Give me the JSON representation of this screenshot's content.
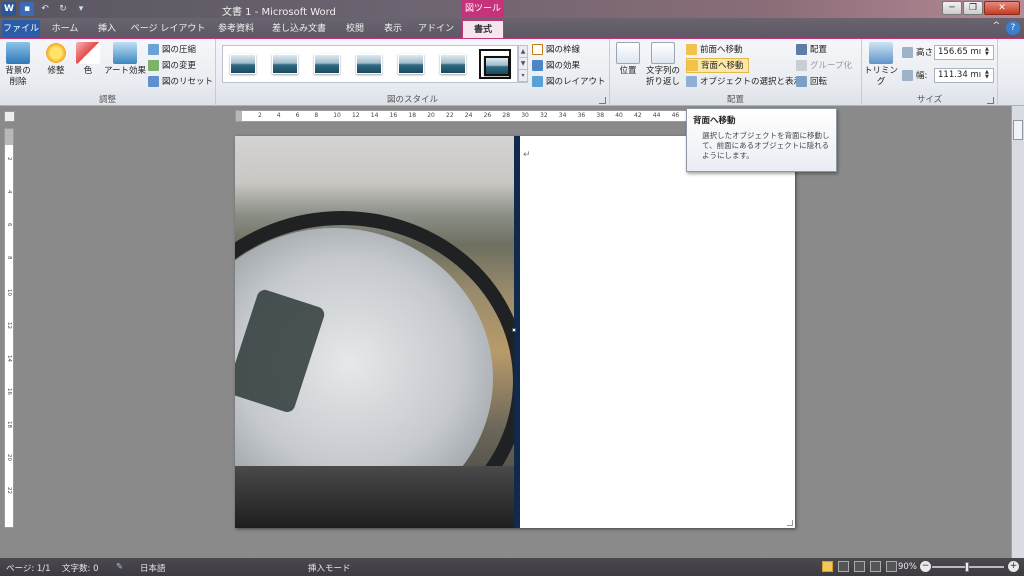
{
  "window": {
    "title": "文書 1 - Microsoft Word",
    "context_tool": "図ツール",
    "minimize": "─",
    "restore": "❐",
    "close": "✕",
    "help": "?",
    "ribbon_toggle": "^"
  },
  "tabs": [
    {
      "label": "ファイル"
    },
    {
      "label": "ホーム"
    },
    {
      "label": "挿入"
    },
    {
      "label": "ページ レイアウト"
    },
    {
      "label": "参考資料"
    },
    {
      "label": "差し込み文書"
    },
    {
      "label": "校閲"
    },
    {
      "label": "表示"
    },
    {
      "label": "アドイン"
    },
    {
      "label": "書式"
    }
  ],
  "ribbon": {
    "adjust": {
      "label": "調整",
      "remove_bg": "背景の削除",
      "correct": "修整",
      "color": "色",
      "art_effects": "アート効果",
      "compress": "図の圧縮",
      "change": "図の変更",
      "reset": "図のリセット"
    },
    "styles": {
      "label": "図のスタイル",
      "border": "図の枠線",
      "effects": "図の効果",
      "layout": "図のレイアウト"
    },
    "arrange": {
      "label": "配置",
      "position": "位置",
      "wrap": "文字列の折り返し",
      "bring_forward": "前面へ移動",
      "send_backward": "背面へ移動",
      "selection_pane": "オブジェクトの選択と表示",
      "align": "配置",
      "group": "グループ化",
      "rotate": "回転"
    },
    "size": {
      "label": "サイズ",
      "crop": "トリミング",
      "height_label": "高さ:",
      "height_value": "156.65 mı",
      "width_label": "幅:",
      "width_value": "111.34 mı"
    }
  },
  "ruler": {
    "h_ticks": [
      "2",
      "4",
      "6",
      "8",
      "10",
      "12",
      "14",
      "16",
      "18",
      "20",
      "22",
      "24",
      "26",
      "28",
      "30",
      "32",
      "34",
      "36",
      "38",
      "40",
      "42",
      "44",
      "46"
    ],
    "v_ticks": [
      "2",
      "4",
      "6",
      "8",
      "10",
      "12",
      "14",
      "16",
      "18",
      "20",
      "22"
    ]
  },
  "tooltip": {
    "title": "背面へ移動",
    "body": "選択したオブジェクトを背面に移動して、前面にあるオブジェクトに隠れるようにします。"
  },
  "document": {
    "paragraph_mark": "↵"
  },
  "status": {
    "page": "ページ: 1/1",
    "words": "文字数: 0",
    "language": "日本語",
    "mode": "挿入モード",
    "zoom": "90%",
    "zoom_out": "−",
    "zoom_in": "+"
  },
  "colors": {
    "context_accent": "#c7337a",
    "file_tab": "#2a5ca8",
    "frame_border": "#0f2a4a"
  }
}
